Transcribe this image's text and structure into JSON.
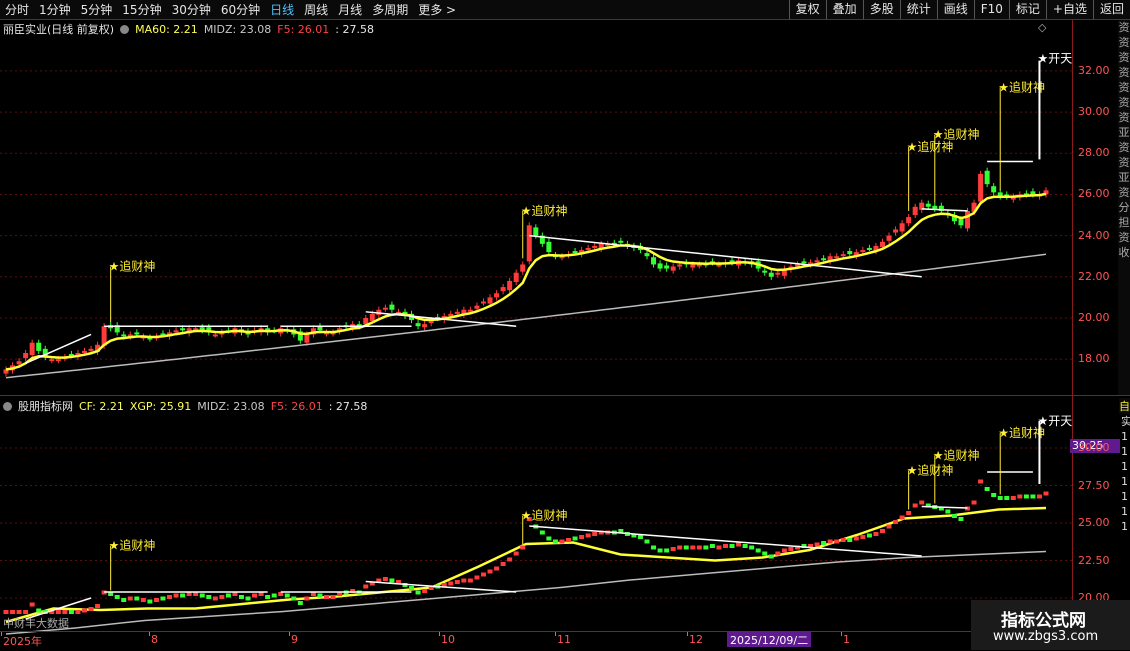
{
  "toolbar": {
    "periods": [
      "分时",
      "1分钟",
      "5分钟",
      "15分钟",
      "30分钟",
      "60分钟",
      "日线",
      "周线",
      "月线",
      "多周期",
      "更多"
    ],
    "active": "日线",
    "more_arrow": ">",
    "buttons": [
      "复权",
      "叠加",
      "多股",
      "统计",
      "画线",
      "F10",
      "标记",
      "+自选",
      "返回"
    ]
  },
  "main_panel": {
    "title": "丽臣实业(日线 前复权)",
    "ma60": "MA60: 2.21",
    "midz": "MIDZ: 23.08",
    "f5": "F5: 26.01",
    "extra": ": 27.58",
    "diamond": "◇",
    "sidebar_chars": "资资资资资资资亚资资亚资分担资收"
  },
  "sub_panel": {
    "title": "股朋指标网",
    "cf": "CF: 2.21",
    "xgp": "XGP: 25.91",
    "midz": "MIDZ: 23.08",
    "f5": "F5: 26.01",
    "extra": ": 27.58",
    "price_box": "30.25",
    "sidebar_label": "自",
    "sidebar_rows": [
      "实",
      "1",
      "1",
      "1",
      "1",
      "1",
      "1",
      "1"
    ]
  },
  "dates": {
    "labels": [
      "2025年",
      "8",
      "9",
      "10",
      "11",
      "12",
      "1"
    ],
    "selected": "2025/12/09/二"
  },
  "source_text": "中财丰大数据",
  "watermark": {
    "name": "指标公式网",
    "url": "www.zbgs3.com"
  },
  "colors": {
    "up": "#ff3b3b",
    "down": "#33ff33",
    "ma_fast": "#ffff33",
    "ma_slow": "#bbbbbb",
    "signal": "#ffee33",
    "trend": "#ffffff"
  },
  "chart_data": [
    {
      "type": "candlestick",
      "title": "丽臣实业(日线 前复权)",
      "y_ticks": [
        18.0,
        20.0,
        22.0,
        24.0,
        26.0,
        28.0,
        30.0,
        32.0
      ],
      "ylim": [
        16.6,
        33.5
      ],
      "closes": [
        17.5,
        17.7,
        17.9,
        18.3,
        18.8,
        18.4,
        18.1,
        18.0,
        18.0,
        18.1,
        18.2,
        18.3,
        18.4,
        18.5,
        18.7,
        19.6,
        19.5,
        19.3,
        19.1,
        19.2,
        19.2,
        19.1,
        19.0,
        19.1,
        19.2,
        19.3,
        19.4,
        19.4,
        19.5,
        19.5,
        19.4,
        19.3,
        19.2,
        19.3,
        19.4,
        19.5,
        19.3,
        19.2,
        19.4,
        19.5,
        19.3,
        19.4,
        19.5,
        19.4,
        19.2,
        18.9,
        19.2,
        19.5,
        19.4,
        19.3,
        19.3,
        19.5,
        19.6,
        19.7,
        19.6,
        20.0,
        20.2,
        20.4,
        20.5,
        20.4,
        20.3,
        20.1,
        19.9,
        19.6,
        19.7,
        19.9,
        20.0,
        20.1,
        20.2,
        20.3,
        20.4,
        20.4,
        20.6,
        20.8,
        21.0,
        21.2,
        21.5,
        21.8,
        22.2,
        22.6,
        24.5,
        24.0,
        23.6,
        23.2,
        23.0,
        23.0,
        23.1,
        23.2,
        23.3,
        23.4,
        23.5,
        23.6,
        23.6,
        23.6,
        23.7,
        23.5,
        23.4,
        23.3,
        23.0,
        22.6,
        22.4,
        22.4,
        22.5,
        22.6,
        22.6,
        22.6,
        22.6,
        22.6,
        22.7,
        22.6,
        22.7,
        22.7,
        22.8,
        22.7,
        22.6,
        22.4,
        22.2,
        22.0,
        22.2,
        22.4,
        22.5,
        22.6,
        22.7,
        22.7,
        22.8,
        22.9,
        23.0,
        23.0,
        23.1,
        23.1,
        23.2,
        23.3,
        23.4,
        23.5,
        23.7,
        24.0,
        24.3,
        24.6,
        24.9,
        25.4,
        25.6,
        25.4,
        25.3,
        25.2,
        25.0,
        24.7,
        24.5,
        25.2,
        25.6,
        27.0,
        26.5,
        26.1,
        25.9,
        25.9,
        25.9,
        26.0,
        26.0,
        26.0,
        26.0,
        26.2
      ]
    },
    {
      "type": "line",
      "title": "股朋指标网",
      "y_ticks": [
        20.0,
        22.5,
        25.0,
        27.5,
        30.0
      ],
      "ylim": [
        18.0,
        32.2
      ],
      "series": [
        {
          "name": "CF",
          "values": [
            18.4,
            19.3,
            19.2,
            19.3,
            19.3,
            19.6,
            19.9,
            20.1,
            20.4,
            20.7,
            22.1,
            23.6,
            23.7,
            22.9,
            22.7,
            22.5,
            22.7,
            23.2,
            24.2,
            25.3,
            25.5,
            25.9,
            26.0
          ]
        },
        {
          "name": "XGP",
          "values": [
            17.6,
            18.0,
            18.5,
            18.8,
            19.1,
            19.5,
            19.9,
            20.3,
            20.7,
            21.2,
            21.6,
            22.0,
            22.4,
            22.7,
            22.9,
            23.1
          ]
        }
      ],
      "signals": [
        "追财神",
        "追财神",
        "追财神",
        "追财神",
        "追财神"
      ],
      "top_signal": "开天"
    }
  ]
}
